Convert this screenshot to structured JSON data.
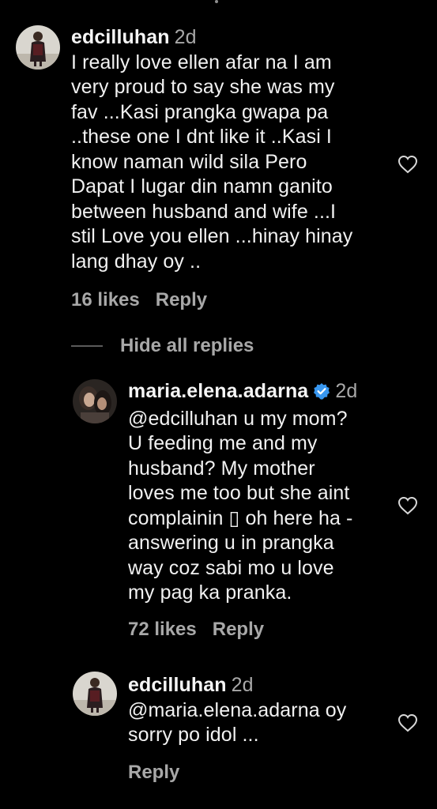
{
  "comments": [
    {
      "username": "edcilluhan",
      "time": "2d",
      "lines": [
        "I really love ellen afar na I am",
        "very proud to say she was my",
        "fav ...Kasi prangka gwapa pa",
        "..these one I dnt like it ..Kasi I",
        "know naman wild sila Pero",
        "Dapat I lugar din namn ganito",
        "between husband and wife ...I",
        "stil Love you ellen ...hinay hinay",
        "lang dhay oy .."
      ],
      "likes": "16 likes",
      "reply": "Reply",
      "avatar_icon": "profile-photo-woman-dark-dress"
    },
    {
      "username": "maria.elena.adarna",
      "time": "2d",
      "verified": true,
      "lines": [
        "@edcilluhan u my mom?",
        "U feeding me and my",
        "husband? My mother",
        "loves me too but she aint",
        "complainin ▯ oh here ha -",
        "answering u in prangka",
        "way coz sabi mo u love",
        "my pag ka pranka."
      ],
      "likes": "72 likes",
      "reply": "Reply",
      "avatar_icon": "profile-photo-couple"
    },
    {
      "username": "edcilluhan",
      "time": "2d",
      "lines": [
        "@maria.elena.adarna oy",
        "sorry po idol ..."
      ],
      "reply": "Reply",
      "avatar_icon": "profile-photo-woman-dark-dress"
    }
  ],
  "hide_replies": "Hide all replies",
  "colors": {
    "background": "#000000",
    "text": "#f1f1f1",
    "muted": "#a8a8a8",
    "verified": "#3897f0"
  }
}
